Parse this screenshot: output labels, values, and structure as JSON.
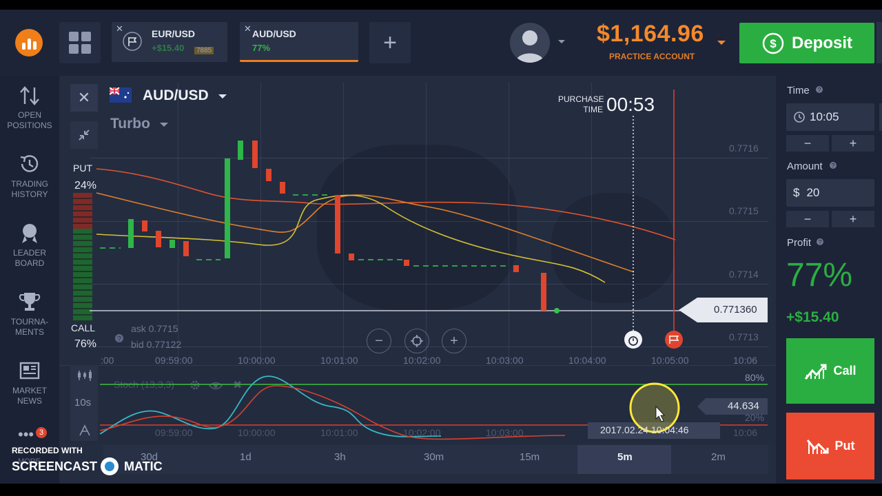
{
  "header": {
    "tabs": [
      {
        "name": "EUR/USD",
        "pct": "+$15.40",
        "extra": "7885"
      },
      {
        "name": "AUD/USD",
        "pct": "77%"
      }
    ],
    "add_tab": "+",
    "balance": "$1,164.96",
    "account_type": "PRACTICE ACCOUNT",
    "deposit_label": "Deposit",
    "accent_orange": "#f5892a",
    "accent_green": "#2bae41"
  },
  "sidebar": {
    "items": [
      {
        "label_1": "OPEN",
        "label_2": "POSITIONS",
        "icon": "arrows-updown-icon"
      },
      {
        "label_1": "TRADING",
        "label_2": "HISTORY",
        "icon": "history-icon"
      },
      {
        "label_1": "LEADER",
        "label_2": "BOARD",
        "icon": "medal-icon"
      },
      {
        "label_1": "TOURNA-",
        "label_2": "MENTS",
        "icon": "trophy-icon"
      },
      {
        "label_1": "MARKET",
        "label_2": "NEWS",
        "icon": "news-icon"
      }
    ],
    "more_badge": "3",
    "more_label": "MORE"
  },
  "chart": {
    "asset": "AUD/USD",
    "mode": "Turbo",
    "purchase_label_1": "PURCHASE",
    "purchase_label_2": "TIME",
    "purchase_time": "00:53",
    "put_label": "PUT",
    "put_pct": "24%",
    "call_label": "CALL",
    "call_pct": "76%",
    "ask": "ask 0.7715",
    "bid": "bid 0.77122",
    "current_price": "0.771360",
    "price_ticks": [
      "0.7716",
      "0.7715",
      "0.7714",
      "0.7713"
    ],
    "time_ticks": [
      "09:59:00",
      "10:00:00",
      "10:01:00",
      "10:02:00",
      "10:03:00",
      "10:04:00",
      "10:05:00",
      "10:06"
    ],
    "sub_time_ticks": [
      "09:59:00",
      "10:00:00",
      "10:01:00",
      "10:02:00",
      "10:03:00",
      "10:06"
    ],
    "first_tick_partial": ":00"
  },
  "indicator": {
    "name": "Stoch (13,3,3)",
    "level_80": "80%",
    "level_20": "20%",
    "value": "44.634",
    "cursor_time": "2017.02.24 10:04:46",
    "period_label": "10s"
  },
  "timeframes": [
    "30d",
    "1d",
    "3h",
    "30m",
    "15m",
    "5m",
    "2m"
  ],
  "timeframe_selected": "5m",
  "right_panel": {
    "time_label": "Time",
    "time_value": "10:05",
    "amount_label": "Amount",
    "amount_currency": "$",
    "amount_value": "20",
    "profit_label": "Profit",
    "profit_pct": "77%",
    "profit_amount": "+$15.40",
    "call_label": "Call",
    "put_label": "Put",
    "minus": "−",
    "plus": "+"
  },
  "watermark": {
    "recorded": "RECORDED WITH",
    "brand_1": "SCREENCAST",
    "brand_2": "MATIC"
  }
}
